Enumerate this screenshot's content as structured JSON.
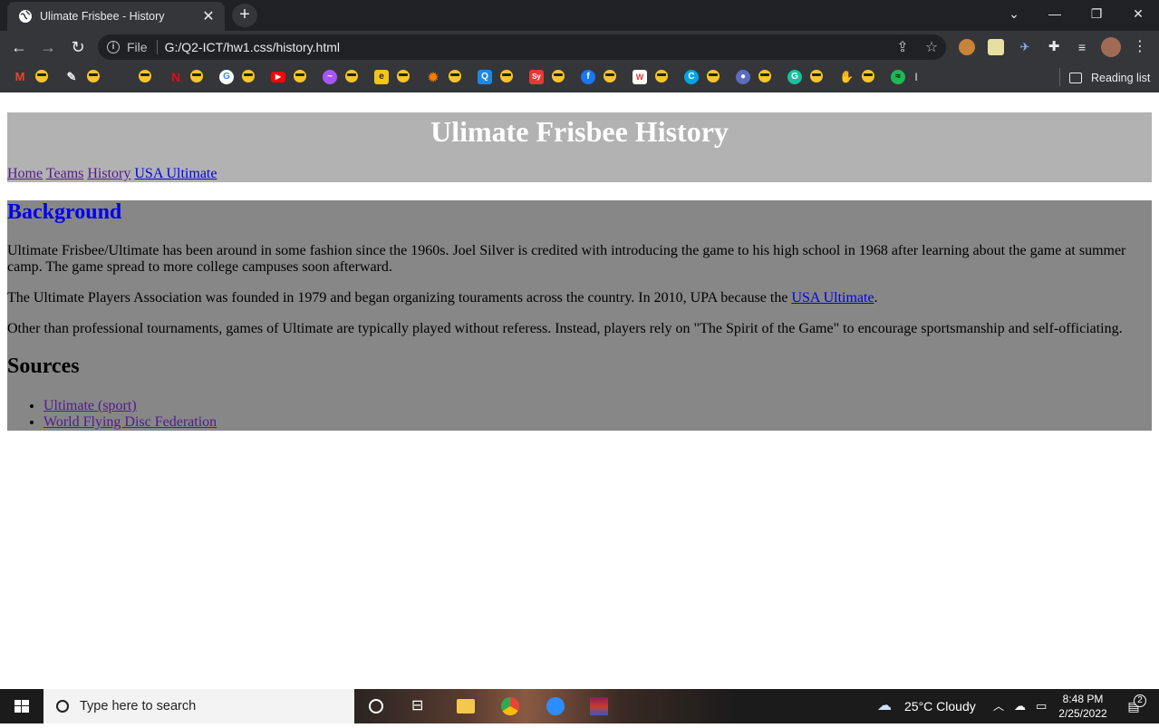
{
  "browser": {
    "tab": {
      "title": "Ulimate Frisbee - History",
      "close": "✕"
    },
    "new_tab": "+",
    "window": {
      "minimize": "—",
      "restore": "❐",
      "close": "✕"
    },
    "omnibox": {
      "scheme": "File",
      "url": "G:/Q2-ICT/hw1.css/history.html"
    },
    "bookmarks": {
      "truncated_label": "I",
      "reading_list": "Reading list"
    }
  },
  "page": {
    "title": "Ulimate Frisbee History",
    "nav": [
      {
        "label": "Home",
        "visited": true
      },
      {
        "label": "Teams",
        "visited": true
      },
      {
        "label": "History",
        "visited": true
      },
      {
        "label": "USA Ultimate",
        "visited": false
      }
    ],
    "background_heading": "Background",
    "para1": "Ultimate Frisbee/Ultimate has been around in some fashion since the 1960s. Joel Silver is credited with introducing the game to his high school in 1968 after learning about the game at summer camp. The game spread to more college campuses soon afterward.",
    "para2_before": "The Ultimate Players Association was founded in 1979 and began organizing touraments across the country. In 2010, UPA because the ",
    "para2_link": "USA Ultimate",
    "para2_after": ".",
    "para3": "Other than professional tournaments, games of Ultimate are typically played without referess. Instead, players rely on \"The Spirit of the Game\" to encourage sportsmanship and self-officiating.",
    "sources_heading": "Sources",
    "sources": [
      "Ultimate (sport)",
      "World Flying Disc Federation"
    ]
  },
  "taskbar": {
    "search_placeholder": "Type here to search",
    "weather": "25°C  Cloudy",
    "time": "8:48 PM",
    "date": "2/25/2022",
    "notifications": "2"
  }
}
